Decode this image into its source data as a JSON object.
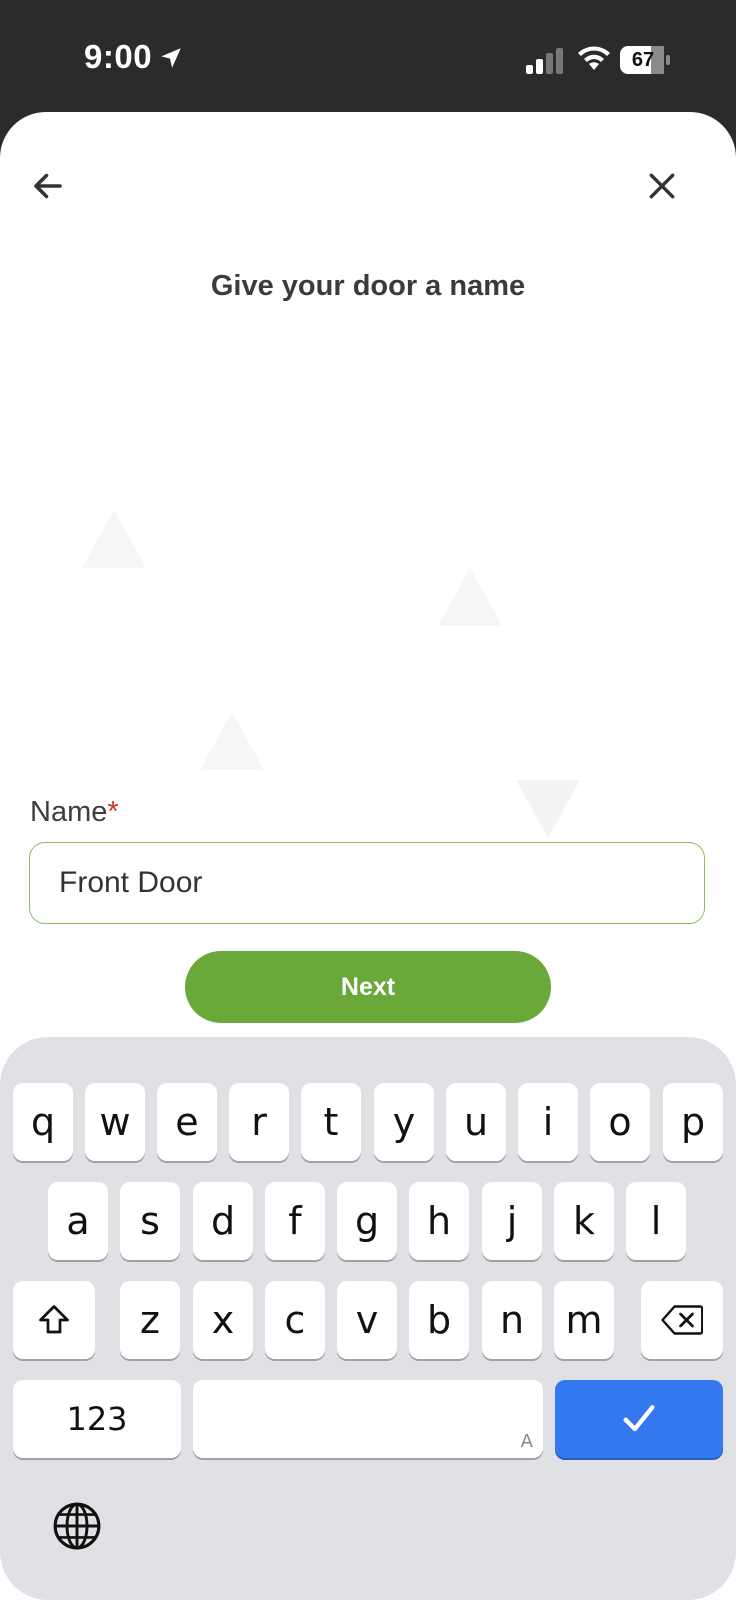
{
  "status_bar": {
    "time": "9:00",
    "battery": "67",
    "icons": [
      "location-arrow-icon",
      "cellular-signal-icon",
      "wifi-icon",
      "battery-icon"
    ]
  },
  "header": {
    "back_icon": "arrow-left-icon",
    "close_icon": "close-icon"
  },
  "page": {
    "title": "Give your door a name"
  },
  "form": {
    "name_label": "Name",
    "required_mark": "*",
    "name_value": "Front Door",
    "next_label": "Next"
  },
  "colors": {
    "accent_green": "#6aa83a",
    "input_border": "#8fbf5a",
    "required_red": "#d0342c",
    "keyboard_done_blue": "#3478f0"
  },
  "keyboard": {
    "row1": [
      "q",
      "w",
      "e",
      "r",
      "t",
      "y",
      "u",
      "i",
      "o",
      "p"
    ],
    "row2": [
      "a",
      "s",
      "d",
      "f",
      "g",
      "h",
      "j",
      "k",
      "l"
    ],
    "row3": [
      "z",
      "x",
      "c",
      "v",
      "b",
      "n",
      "m"
    ],
    "numbers_label": "123",
    "space_hint": "A",
    "icons": [
      "shift-icon",
      "backspace-icon",
      "checkmark-icon",
      "globe-icon"
    ]
  }
}
